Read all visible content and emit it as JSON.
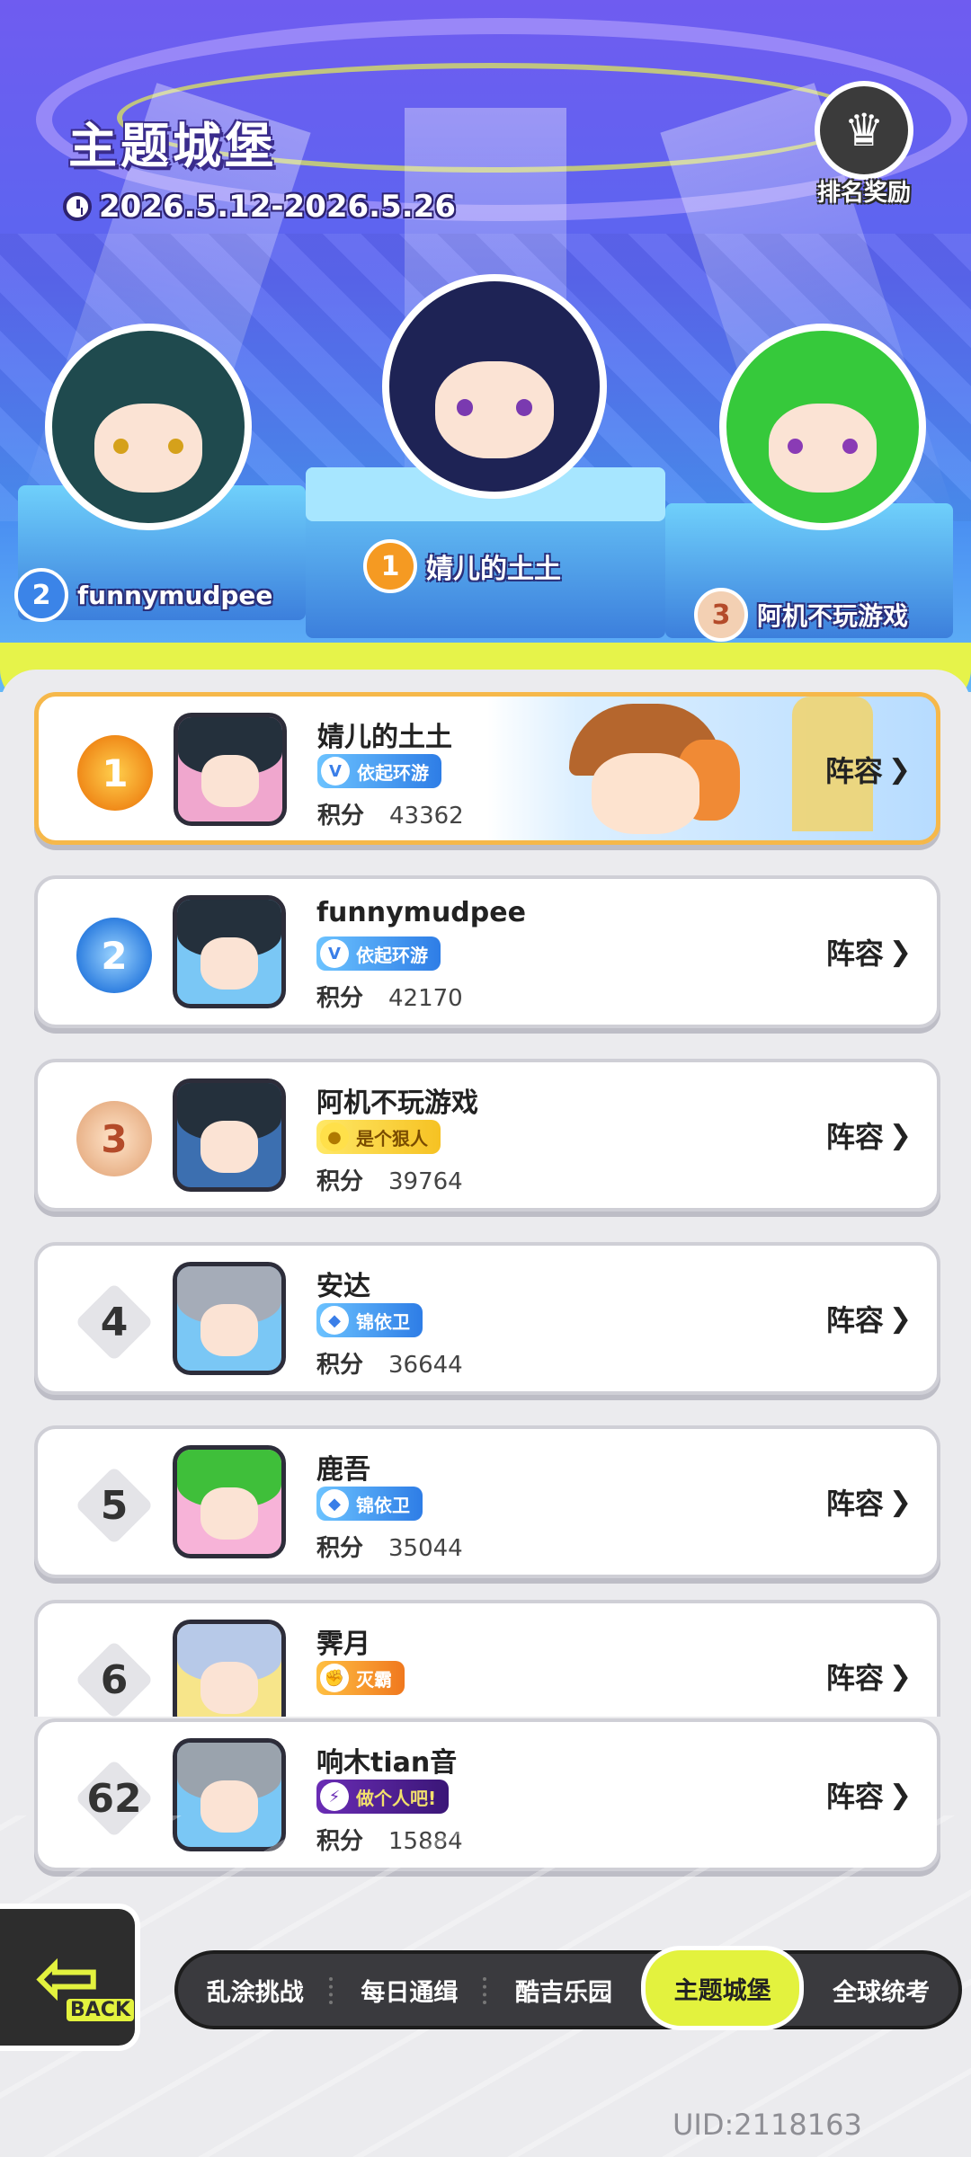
{
  "header": {
    "title": "主题城堡",
    "date_range": "2026.5.12-2026.5.26",
    "reward_label": "排名奖励",
    "reward_icon": "trophy-shield-icon"
  },
  "podium": [
    {
      "rank": "2",
      "name": "funnymudpee"
    },
    {
      "rank": "1",
      "name": "婧儿的土土"
    },
    {
      "rank": "3",
      "name": "阿机不玩游戏"
    }
  ],
  "leaderboard": {
    "score_label": "积分",
    "lineup_label": "阵容",
    "rows": [
      {
        "rank": "1",
        "name": "婧儿的土土",
        "tag": "依起环游",
        "score": "43362"
      },
      {
        "rank": "2",
        "name": "funnymudpee",
        "tag": "依起环游",
        "score": "42170"
      },
      {
        "rank": "3",
        "name": "阿机不玩游戏",
        "tag": "是个狠人",
        "score": "39764"
      },
      {
        "rank": "4",
        "name": "安达",
        "tag": "锦依卫",
        "score": "36644"
      },
      {
        "rank": "5",
        "name": "鹿吾",
        "tag": "锦依卫",
        "score": "35044"
      },
      {
        "rank": "6",
        "name": "霁月",
        "tag": "灭霸",
        "score": ""
      }
    ],
    "self": {
      "rank": "62",
      "name": "响木tian音",
      "tag": "做个人吧!",
      "score": "15884"
    }
  },
  "nav": {
    "back_label": "BACK",
    "tabs": [
      "乱涂挑战",
      "每日通缉",
      "酷吉乐园",
      "主题城堡",
      "全球统考"
    ],
    "active_tab": "主题城堡"
  },
  "uid": "UID:2118163",
  "colors": {
    "accent": "#e3f23e",
    "gold_border": "#f6b84a",
    "hero_top": "#6f5cf0",
    "hero_bottom": "#63b7f7"
  }
}
